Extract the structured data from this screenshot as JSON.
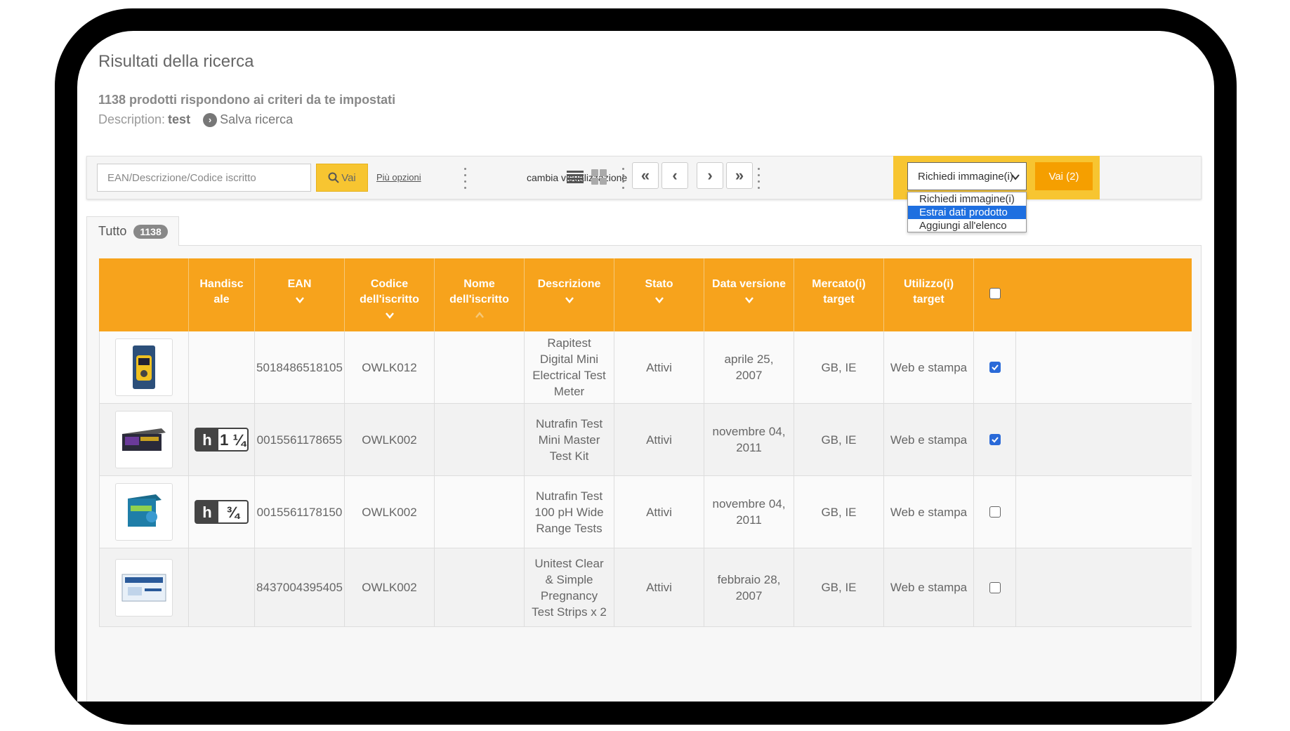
{
  "page": {
    "title": "Risultati della ricerca",
    "summary": "1138 prodotti rispondono ai criteri da te impostati",
    "description_label": "Description:",
    "description_value": "test",
    "save_search": "Salva ricerca"
  },
  "toolbar": {
    "search_placeholder": "EAN/Descrizione/Codice iscritto",
    "search_button": "Vai",
    "more_options": "Più opzioni",
    "view_label": "cambia visualizzazione",
    "icons": [
      "list-view-icon",
      "grid-view-icon",
      "first-page-icon",
      "prev-page-icon",
      "next-page-icon",
      "last-page-icon"
    ]
  },
  "actions": {
    "selected": "Richiedi immagine(i)",
    "go_button": "Vai (2)",
    "options": [
      "Richiedi immagine(i)",
      "Estrai dati prodotto",
      "Aggiungi all'elenco"
    ],
    "highlighted": "Estrai dati prodotto"
  },
  "tabs": [
    {
      "label": "Tutto",
      "count": "1138"
    }
  ],
  "table": {
    "headers": [
      "",
      "Handiscale",
      "EAN",
      "Codice dell'iscritto",
      "Nome dell'iscritto",
      "Descrizione",
      "Stato",
      "Data versione",
      "Mercato(i) target",
      "Utilizzo(i) target",
      ""
    ],
    "rows": [
      {
        "handiscale": "",
        "ean": "5018486518105",
        "code": "OWLK012",
        "name": "",
        "desc": "Rapitest Digital Mini Electrical Test Meter",
        "status": "Attivi",
        "date": "aprile 25, 2007",
        "market": "GB, IE",
        "usage": "Web e stampa",
        "checked": true
      },
      {
        "handiscale": "1 ¼",
        "ean": "0015561178655",
        "code": "OWLK002",
        "name": "",
        "desc": "Nutrafin Test Mini Master Test Kit",
        "status": "Attivi",
        "date": "novembre 04, 2011",
        "market": "GB, IE",
        "usage": "Web e stampa",
        "checked": true
      },
      {
        "handiscale": "¾",
        "ean": "0015561178150",
        "code": "OWLK002",
        "name": "",
        "desc": "Nutrafin Test 100 pH Wide Range Tests",
        "status": "Attivi",
        "date": "novembre 04, 2011",
        "market": "GB, IE",
        "usage": "Web e stampa",
        "checked": false
      },
      {
        "handiscale": "",
        "ean": "8437004395405",
        "code": "OWLK002",
        "name": "",
        "desc": "Unitest Clear & Simple Pregnancy Test Strips x 2",
        "status": "Attivi",
        "date": "febbraio 28, 2007",
        "market": "GB, IE",
        "usage": "Web e stampa",
        "checked": false
      }
    ]
  },
  "colors": {
    "accent": "#f7a31c",
    "button": "#f7c531",
    "go": "#f59f00",
    "selected_option": "#1e6fe0"
  }
}
